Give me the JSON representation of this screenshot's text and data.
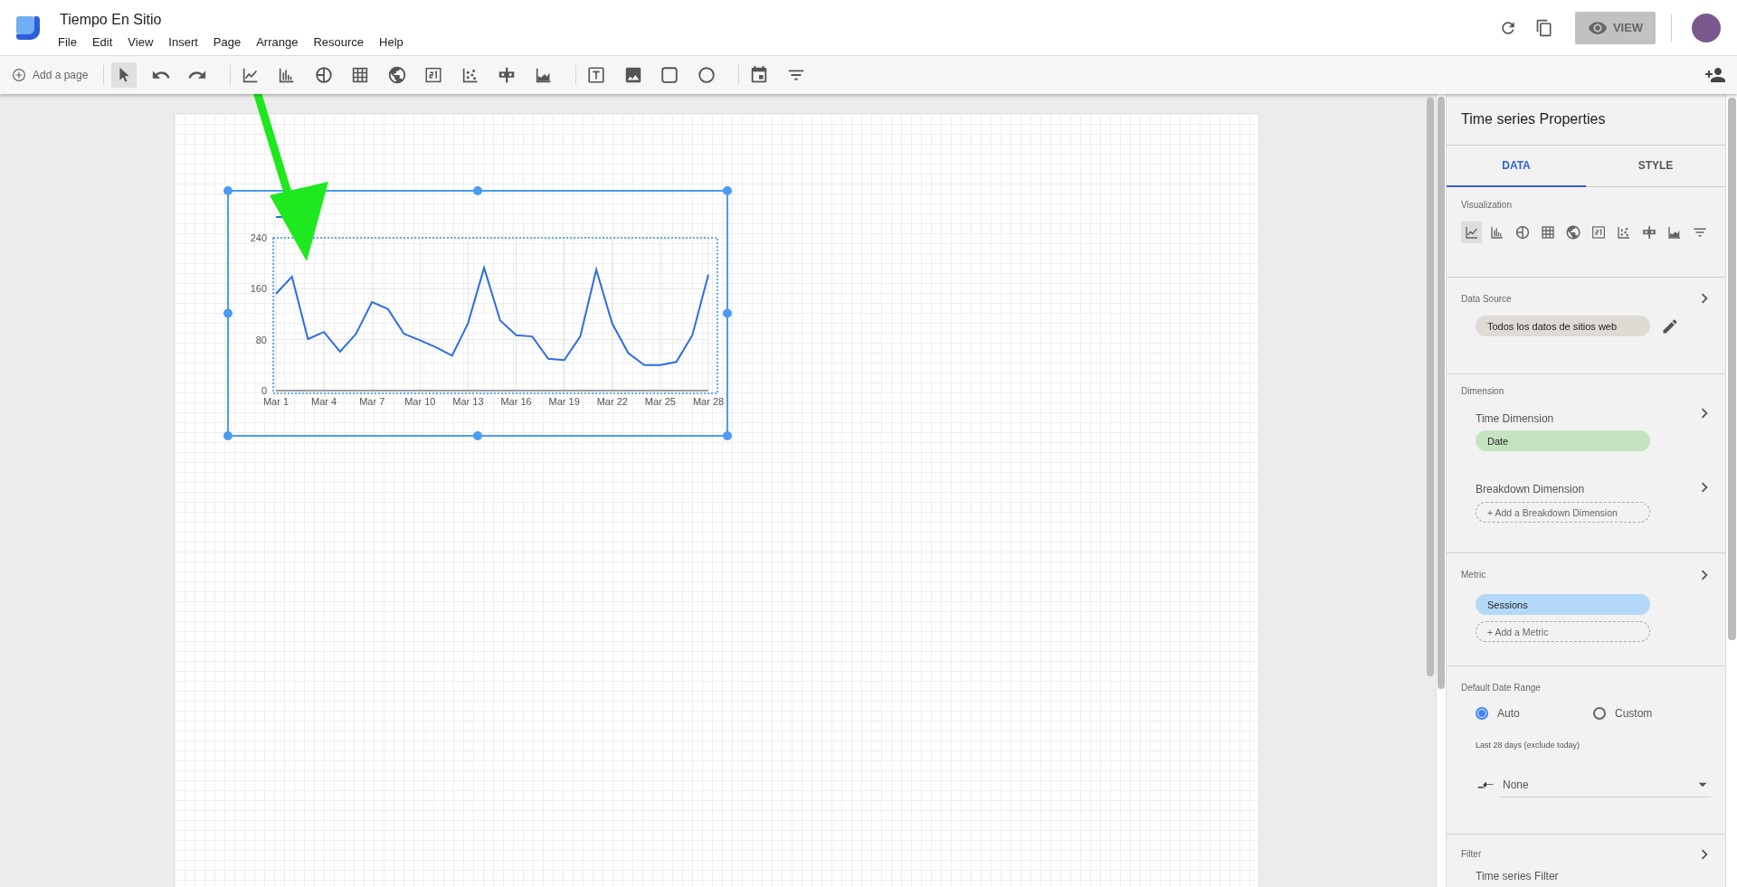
{
  "app": {
    "title": "Tiempo En Sitio",
    "menu": [
      "File",
      "Edit",
      "View",
      "Insert",
      "Page",
      "Arrange",
      "Resource",
      "Help"
    ],
    "view_button": "VIEW"
  },
  "toolbar": {
    "add_page": "Add a page",
    "tools": [
      {
        "kind": "pointer",
        "selected": true
      },
      {
        "kind": "undo",
        "selected": false
      },
      {
        "kind": "redo",
        "selected": false
      },
      {
        "kind": "line",
        "selected": false
      },
      {
        "kind": "bar",
        "selected": false
      },
      {
        "kind": "pie",
        "selected": false
      },
      {
        "kind": "table",
        "selected": false
      },
      {
        "kind": "geo",
        "selected": false
      },
      {
        "kind": "scorecard",
        "selected": false
      },
      {
        "kind": "scatter",
        "selected": false
      },
      {
        "kind": "bullet",
        "selected": false
      },
      {
        "kind": "area",
        "selected": false
      },
      {
        "kind": "text",
        "selected": false
      },
      {
        "kind": "image",
        "selected": false
      },
      {
        "kind": "rectangle",
        "selected": false
      },
      {
        "kind": "circle",
        "selected": false
      },
      {
        "kind": "date",
        "selected": false
      },
      {
        "kind": "filter",
        "selected": false
      }
    ]
  },
  "chart": {
    "chart_data": {
      "type": "line",
      "categories": [
        "Mar 1",
        null,
        null,
        "Mar 4",
        null,
        null,
        "Mar 7",
        null,
        null,
        "Mar 10",
        null,
        null,
        "Mar 13",
        null,
        null,
        "Mar 16",
        null,
        null,
        "Mar 19",
        null,
        null,
        "Mar 22",
        null,
        null,
        "Mar 25",
        null,
        null,
        "Mar 28"
      ],
      "series": [
        {
          "color": "#2f6de1",
          "values": [
            152,
            179,
            81,
            92,
            61,
            89,
            139,
            128,
            89,
            79,
            68,
            55,
            106,
            193,
            110,
            87,
            85,
            50,
            48,
            85,
            190,
            105,
            59,
            40,
            40,
            45,
            87,
            182
          ]
        }
      ],
      "ylim": [
        0,
        240
      ],
      "yticks": [
        0,
        80,
        160,
        240
      ],
      "grid": true
    }
  },
  "panel": {
    "title": "Time series Properties",
    "tabs": [
      {
        "label": "DATA",
        "selected": true
      },
      {
        "label": "STYLE",
        "selected": false
      }
    ],
    "visualization": {
      "label": "Visualization",
      "types": [
        {
          "kind": "line",
          "selected": true
        },
        {
          "kind": "bar",
          "selected": false
        },
        {
          "kind": "pie",
          "selected": false
        },
        {
          "kind": "table",
          "selected": false
        },
        {
          "kind": "geo",
          "selected": false
        },
        {
          "kind": "scorecard",
          "selected": false
        },
        {
          "kind": "scatter",
          "selected": false
        },
        {
          "kind": "bullet",
          "selected": false
        },
        {
          "kind": "area",
          "selected": false
        },
        {
          "kind": "filter",
          "selected": false
        }
      ]
    },
    "data_source": {
      "label": "Data Source",
      "chip": "Todos los datos de sitios web"
    },
    "dimension": {
      "label": "Dimension",
      "time_label": "Time Dimension",
      "time_chip": "Date",
      "breakdown_label": "Breakdown Dimension",
      "breakdown_add": "+ Add a Breakdown Dimension"
    },
    "metric": {
      "label": "Metric",
      "chips": [
        "Sessions"
      ],
      "add": "+ Add a Metric"
    },
    "date_range": {
      "label": "Default Date Range",
      "options": [
        {
          "label": "Auto",
          "selected": true
        },
        {
          "label": "Custom",
          "selected": false
        }
      ],
      "note": "Last 28 days (exclude today)",
      "comparison": "None"
    },
    "filter": {
      "label": "Filter",
      "sub": "Time series Filter"
    }
  }
}
